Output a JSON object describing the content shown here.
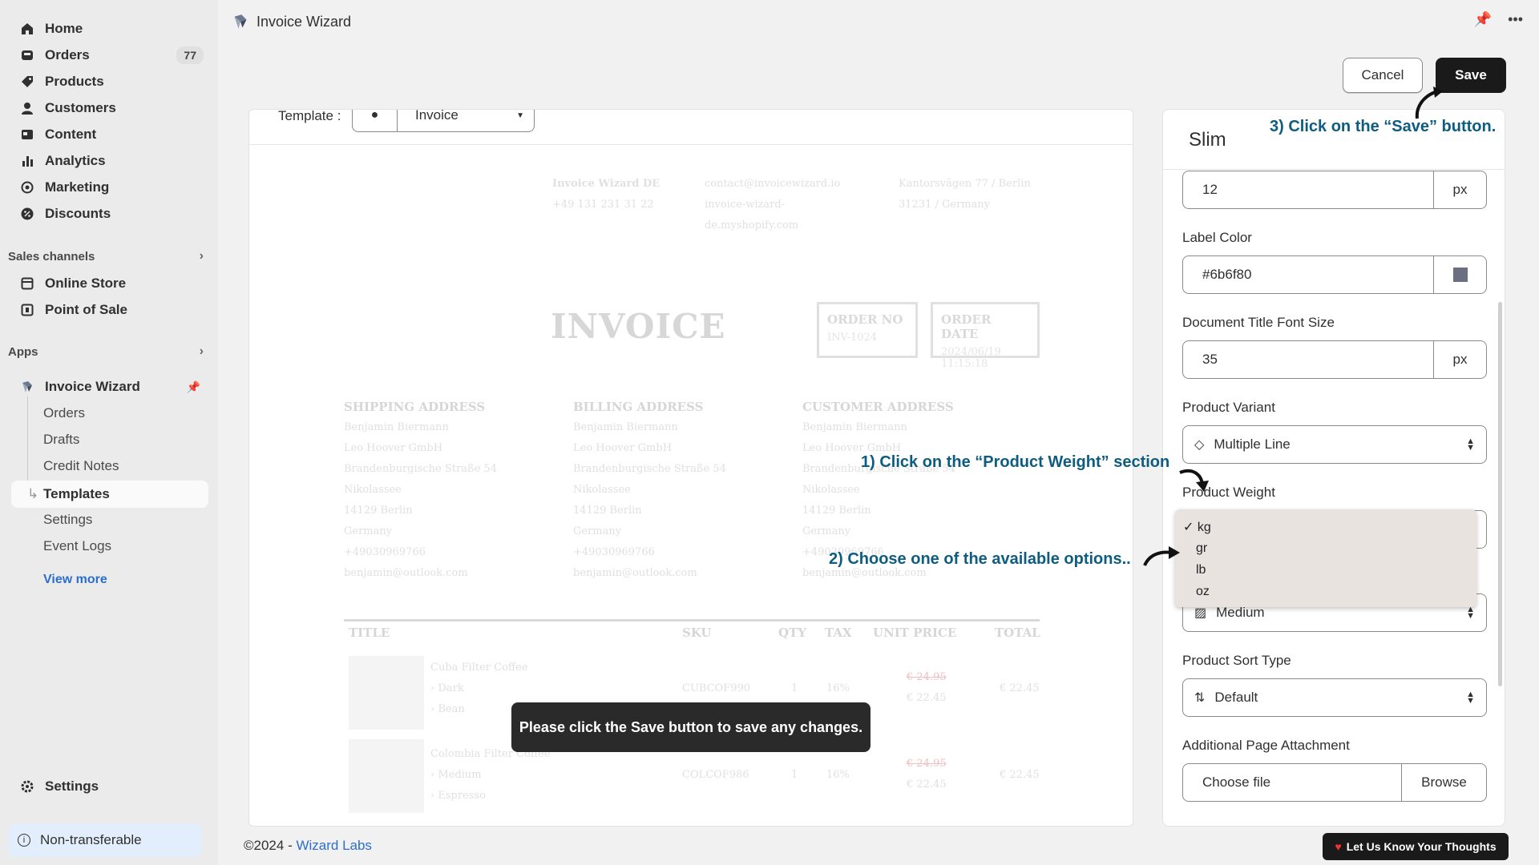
{
  "sidebar": {
    "nav": [
      {
        "label": "Home",
        "icon": "home-icon"
      },
      {
        "label": "Orders",
        "icon": "orders-icon",
        "badge": "77"
      },
      {
        "label": "Products",
        "icon": "tag-icon"
      },
      {
        "label": "Customers",
        "icon": "person-icon"
      },
      {
        "label": "Content",
        "icon": "content-icon"
      },
      {
        "label": "Analytics",
        "icon": "bar-chart-icon"
      },
      {
        "label": "Marketing",
        "icon": "marketing-icon"
      },
      {
        "label": "Discounts",
        "icon": "discount-icon"
      }
    ],
    "sales_channels": {
      "title": "Sales channels",
      "items": [
        {
          "label": "Online Store",
          "icon": "store-icon"
        },
        {
          "label": "Point of Sale",
          "icon": "pos-icon"
        }
      ]
    },
    "apps": {
      "title": "Apps",
      "app_name": "Invoice Wizard",
      "sub_items": [
        "Orders",
        "Drafts",
        "Credit Notes",
        "Templates",
        "Settings",
        "Event Logs"
      ],
      "active": "Templates",
      "view_more": "View more"
    },
    "settings": "Settings",
    "non_transferable": "Non-transferable"
  },
  "topbar": {
    "title": "Invoice Wizard"
  },
  "actions": {
    "cancel": "Cancel",
    "save": "Save"
  },
  "preview": {
    "template_label": "Template :",
    "template_value": "Invoice",
    "company": {
      "name": "Invoice Wizard DE",
      "phone": "+49 131 231 31 22",
      "email": "contact@invoicewizard.io",
      "site": "invoice-wizard-de.myshopify.com",
      "address1": "Kantorsvägen 77 / Berlin",
      "address2": "31231 / Germany"
    },
    "title": "INVOICE",
    "order_no_label": "ORDER NO",
    "order_no": "INV-1024",
    "order_date_label": "ORDER DATE",
    "order_date": "2024/06/19 11:15:18",
    "addresses": [
      {
        "title": "SHIPPING ADDRESS",
        "lines": [
          "Benjamin Biermann",
          "Leo Hoover GmbH",
          "Brandenburgische Straße 54",
          "Nikolassee",
          "14129 Berlin",
          "Germany",
          "+49030969766",
          "benjamin@outlook.com"
        ]
      },
      {
        "title": "BILLING ADDRESS",
        "lines": [
          "Benjamin Biermann",
          "Leo Hoover GmbH",
          "Brandenburgische Straße 54",
          "Nikolassee",
          "14129 Berlin",
          "Germany",
          "+49030969766",
          "benjamin@outlook.com"
        ]
      },
      {
        "title": "CUSTOMER ADDRESS",
        "lines": [
          "Benjamin Biermann",
          "Leo Hoover GmbH",
          "Brandenburgische Straße 54",
          "Nikolassee",
          "14129 Berlin",
          "Germany",
          "+49030969766",
          "benjamin@outlook.com"
        ]
      }
    ],
    "table_headers": [
      "TITLE",
      "SKU",
      "QTY",
      "TAX",
      "UNIT PRICE",
      "TOTAL"
    ],
    "rows": [
      {
        "title": "Cuba Filter Coffee",
        "v1": "Dark",
        "v2": "Bean",
        "sku": "CUBCOF990",
        "qty": "1",
        "tax": "16%",
        "old": "€ 24.95",
        "price": "€ 22.45",
        "total": "€ 22.45"
      },
      {
        "title": "Colombia Filter Coffee",
        "v1": "Medium",
        "v2": "Espresso",
        "sku": "COLCOF986",
        "qty": "1",
        "tax": "16%",
        "old": "€ 24.95",
        "price": "€ 22.45",
        "total": "€ 22.45"
      }
    ]
  },
  "toast": "Please click the Save button to save any changes.",
  "panel": {
    "title": "Slim",
    "font_size_value": "12",
    "unit": "px",
    "label_color_label": "Label Color",
    "label_color_value": "#6b6f80",
    "doc_title_font_label": "Document Title Font Size",
    "doc_title_font_value": "35",
    "variant_label": "Product Variant",
    "variant_value": "Multiple Line",
    "weight_label": "Product Weight",
    "image_size_value": "Medium",
    "sort_label": "Product Sort Type",
    "sort_value": "Default",
    "attach_label": "Additional Page Attachment",
    "attach_value": "Choose file",
    "browse": "Browse"
  },
  "weight_options": [
    "kg",
    "gr",
    "lb",
    "oz"
  ],
  "weight_selected": "kg",
  "annotations": {
    "step1": "1) Click on the “Product Weight” section",
    "step2": "2) Choose one of the available options..",
    "step3": "3) Click on the “Save” button."
  },
  "footer": {
    "copyright": "©2024 - ",
    "company": "Wizard Labs",
    "feedback": "Let Us Know Your Thoughts"
  },
  "colors": {
    "accent": "#2c6ecb",
    "annotation": "#0e5c80",
    "primary_button": "#1a1a1a",
    "label_swatch": "#6b6f80"
  }
}
